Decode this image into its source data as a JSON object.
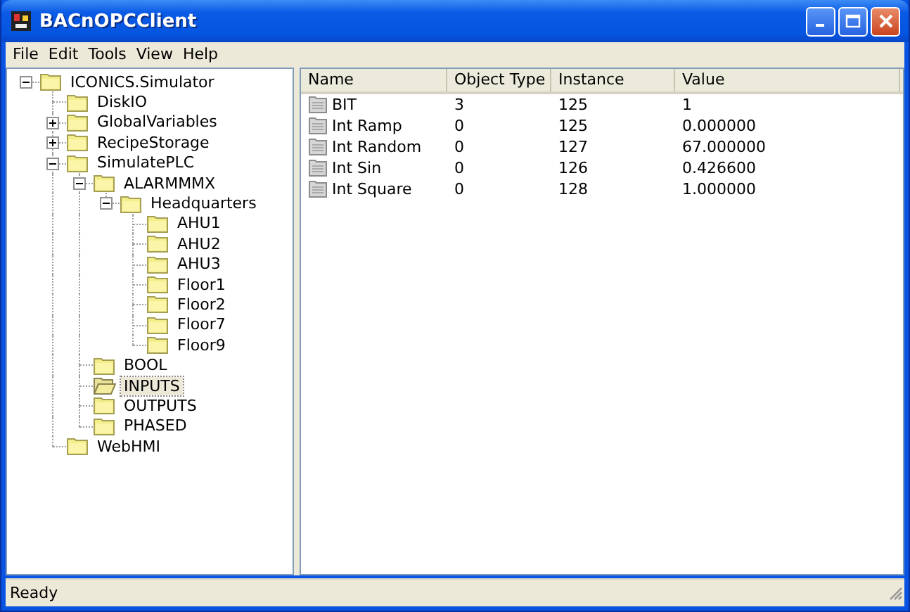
{
  "window": {
    "title": "BACnOPCClient"
  },
  "menu": [
    "File",
    "Edit",
    "Tools",
    "View",
    "Help"
  ],
  "tree": [
    {
      "label": "ICONICS.Simulator",
      "expanded": true,
      "selected": false,
      "children": [
        {
          "label": "DiskIO",
          "selected": false
        },
        {
          "label": "GlobalVariables",
          "expanded": false,
          "selected": false
        },
        {
          "label": "RecipeStorage",
          "expanded": false,
          "selected": false
        },
        {
          "label": "SimulatePLC",
          "expanded": true,
          "selected": false,
          "children": [
            {
              "label": "ALARMMMX",
              "expanded": true,
              "selected": false,
              "children": [
                {
                  "label": "Headquarters",
                  "expanded": true,
                  "selected": false,
                  "children": [
                    {
                      "label": "AHU1",
                      "selected": false
                    },
                    {
                      "label": "AHU2",
                      "selected": false
                    },
                    {
                      "label": "AHU3",
                      "selected": false
                    },
                    {
                      "label": "Floor1",
                      "selected": false
                    },
                    {
                      "label": "Floor2",
                      "selected": false
                    },
                    {
                      "label": "Floor7",
                      "selected": false
                    },
                    {
                      "label": "Floor9",
                      "selected": false
                    }
                  ]
                }
              ]
            },
            {
              "label": "BOOL",
              "selected": false
            },
            {
              "label": "INPUTS",
              "selected": true
            },
            {
              "label": "OUTPUTS",
              "selected": false
            },
            {
              "label": "PHASED",
              "selected": false
            }
          ]
        },
        {
          "label": "WebHMI",
          "selected": false
        }
      ]
    }
  ],
  "table": {
    "columns": [
      "Name",
      "Object Type",
      "Instance",
      "Value"
    ],
    "rows": [
      [
        "BIT",
        "3",
        "125",
        "1"
      ],
      [
        "Int Ramp",
        "0",
        "125",
        "0.000000"
      ],
      [
        "Int Random",
        "0",
        "127",
        "67.000000"
      ],
      [
        "Int Sin",
        "0",
        "126",
        "0.426600"
      ],
      [
        "Int Square",
        "0",
        "128",
        "1.000000"
      ]
    ]
  },
  "status_bar": "Ready"
}
